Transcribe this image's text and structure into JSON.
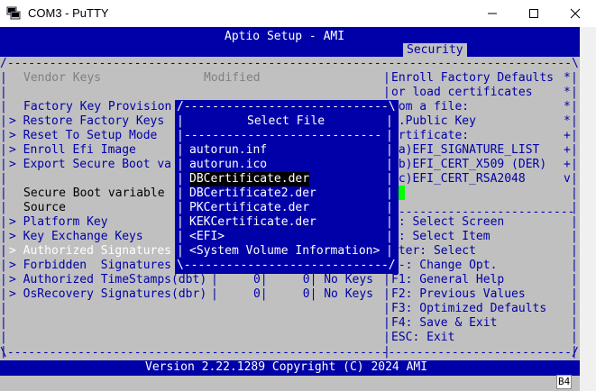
{
  "window": {
    "title": "COM3 - PuTTY",
    "colors": {
      "terminal_bg": "#c0c0c0",
      "header_blue": "#0000a8",
      "white": "#ffffff",
      "text_blue": "#0000a8",
      "cursor": "#00ff00"
    }
  },
  "header": {
    "title": "Aptio Setup - AMI",
    "active_tab": "Security"
  },
  "left_panel": {
    "vendor_keys_label": "Vendor Keys",
    "vendor_keys_value": "Modified",
    "factory_key_provision": "Factory Key Provision",
    "restore_factory_keys": "> Restore Factory Keys",
    "reset_to_setup_mode": "> Reset To Setup Mode",
    "enroll_efi_image": "> Enroll Efi Image",
    "export_secure_boot": "> Export Secure Boot va",
    "secure_boot_variable": "Secure Boot variable",
    "source": "Source",
    "platform_key": "> Platform Key",
    "key_exchange_keys": "> Key Exchange Keys",
    "authorized_signatures": "> Authorized Signatures",
    "forbidden_signatures": "> Forbidden  Signatures",
    "authorized_timestamps": "> Authorized TimeStamps(dbt)",
    "authorized_timestamps_vals": "|     0|     0| No Keys",
    "osrecovery_signatures": "> OsRecovery Signatures(dbr)",
    "osrecovery_signatures_vals": "|     0|     0| No Keys"
  },
  "help_panel": [
    "Enroll Factory Defaults ",
    "or load certificates    ",
    "rom a file:             ",
    "1.Public Key            ",
    "ertificate:             ",
    " a)EFI_SIGNATURE_LIST   ",
    " b)EFI_CERT_X509 (DER)  ",
    " c)EFI_CERT_RSA2048     "
  ],
  "help_side_marks": [
    "*",
    "*",
    "*",
    "*",
    "+",
    "+",
    "+",
    "v"
  ],
  "keys_help": [
    "<: Select Screen",
    "v: Select Item",
    "nter: Select",
    "/-: Change Opt.",
    "F1: General Help",
    "F2: Previous Values",
    "F3: Optimized Defaults",
    "F4: Save & Exit",
    "ESC: Exit"
  ],
  "dialog": {
    "title": "Select File",
    "items": [
      "autorun.inf",
      "autorun.ico",
      "DBCertificate.der",
      "DBCertificate2.der",
      "PKCertificate.der",
      "KEKCertificate.der",
      "<EFI>",
      "<System Volume Information>"
    ],
    "selected_index": 2
  },
  "footer": {
    "version": "Version 2.22.1289 Copyright (C) 2024 AMI",
    "badge": "B4"
  }
}
